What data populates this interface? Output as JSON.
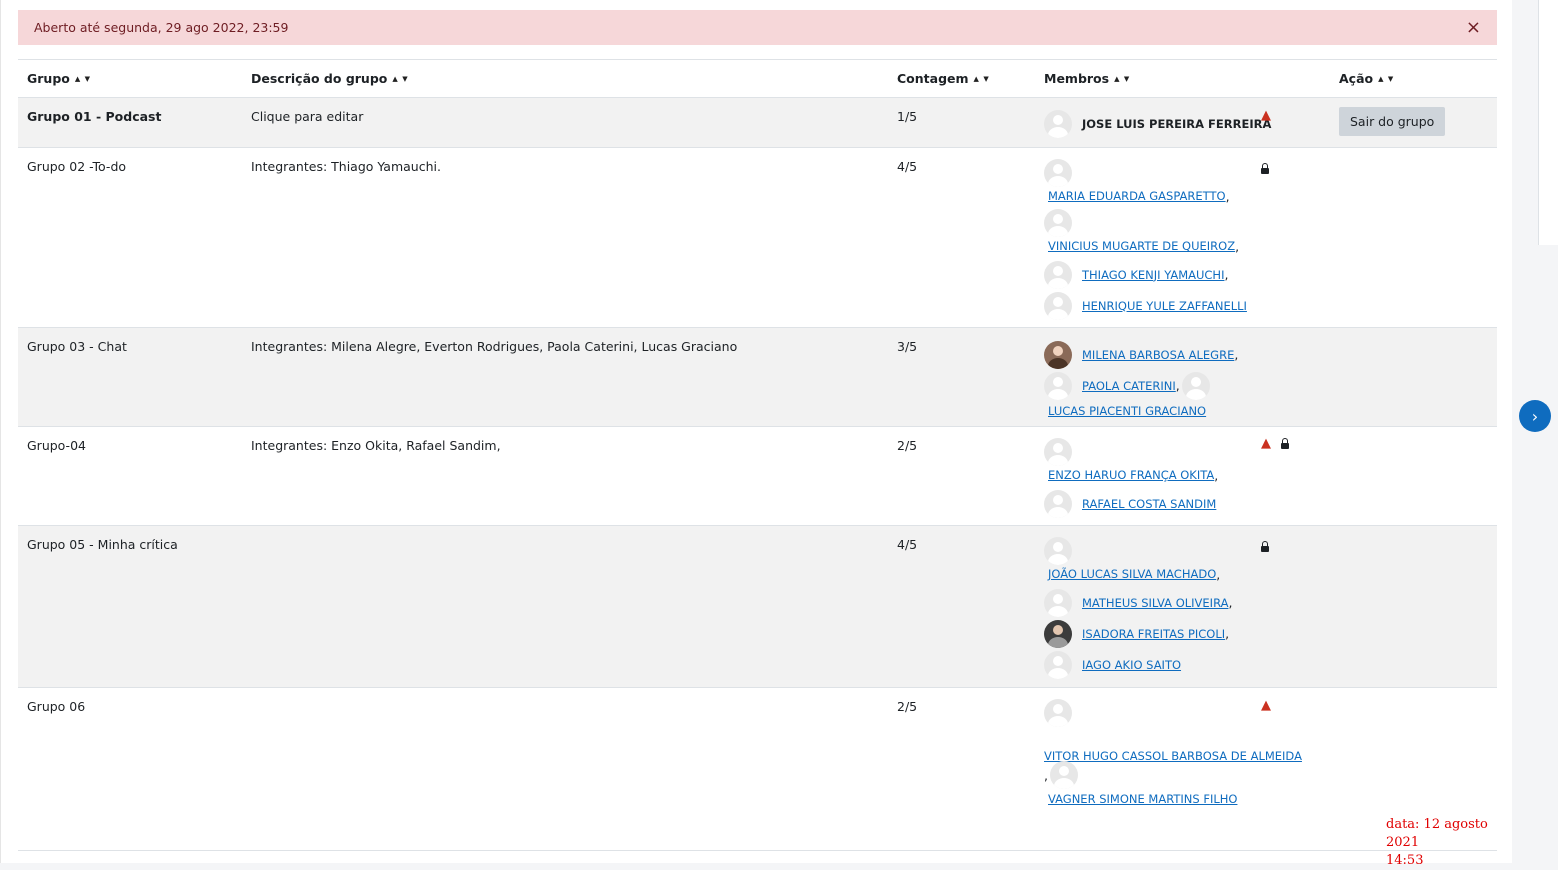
{
  "alert": {
    "text": "Aberto até segunda, 29 ago 2022, 23:59",
    "close": "×"
  },
  "table": {
    "headers": [
      "Grupo",
      "Descrição do grupo",
      "Contagem",
      "Membros",
      "Ação"
    ],
    "sort_glyph": "▲ ▼",
    "rows": [
      {
        "group": "Grupo 01 - Podcast",
        "description": "Clique para editar",
        "count": "1/5",
        "members": [
          "JOSE LUIS PEREIRA FERREIRA"
        ],
        "action": "Sair do grupo"
      },
      {
        "group": "Grupo 02 -To-do",
        "description": "Integrantes: Thiago Yamauchi.",
        "count": "4/5",
        "members": [
          "MARIA EDUARDA GASPARETTO",
          "VINICIUS MUGARTE DE QUEIROZ",
          "THIAGO KENJI YAMAUCHI",
          "HENRIQUE YULE ZAFFANELLI"
        ]
      },
      {
        "group": "Grupo 03 - Chat",
        "description": "Integrantes: Milena Alegre, Everton Rodrigues, Paola Caterini, Lucas Graciano",
        "count": "3/5",
        "members": [
          "MILENA BARBOSA ALEGRE",
          "PAOLA CATERINI",
          "LUCAS PIACENTI GRACIANO"
        ]
      },
      {
        "group": "Grupo-04",
        "description": "Integrantes: Enzo Okita, Rafael Sandim,",
        "count": "2/5",
        "members": [
          "ENZO HARUO FRANÇA OKITA",
          "RAFAEL COSTA SANDIM"
        ]
      },
      {
        "group": "Grupo 05 - Minha crítica",
        "description": "",
        "count": "4/5",
        "members": [
          "JOÃO LUCAS SILVA MACHADO",
          "MATHEUS SILVA OLIVEIRA",
          "ISADORA FREITAS PICOLI",
          "IAGO AKIO SAITO"
        ]
      },
      {
        "group": "Grupo 06",
        "description": "",
        "count": "2/5",
        "members": [
          "VITOR HUGO CASSOL BARBOSA DE ALMEIDA",
          "VAGNER SIMONE MARTINS FILHO"
        ]
      }
    ]
  },
  "separator": ",",
  "icons": {
    "warning": "warning-icon",
    "lock": "lock-icon",
    "drawer": "chevron-right-icon"
  },
  "stamp": {
    "line1": "data: 12 agosto 2021",
    "line2": "14:53"
  },
  "colors": {
    "link": "#0f6cbf",
    "alert_bg": "#f6d7d9",
    "warning": "#ca3120",
    "stamp": "#e00000"
  }
}
